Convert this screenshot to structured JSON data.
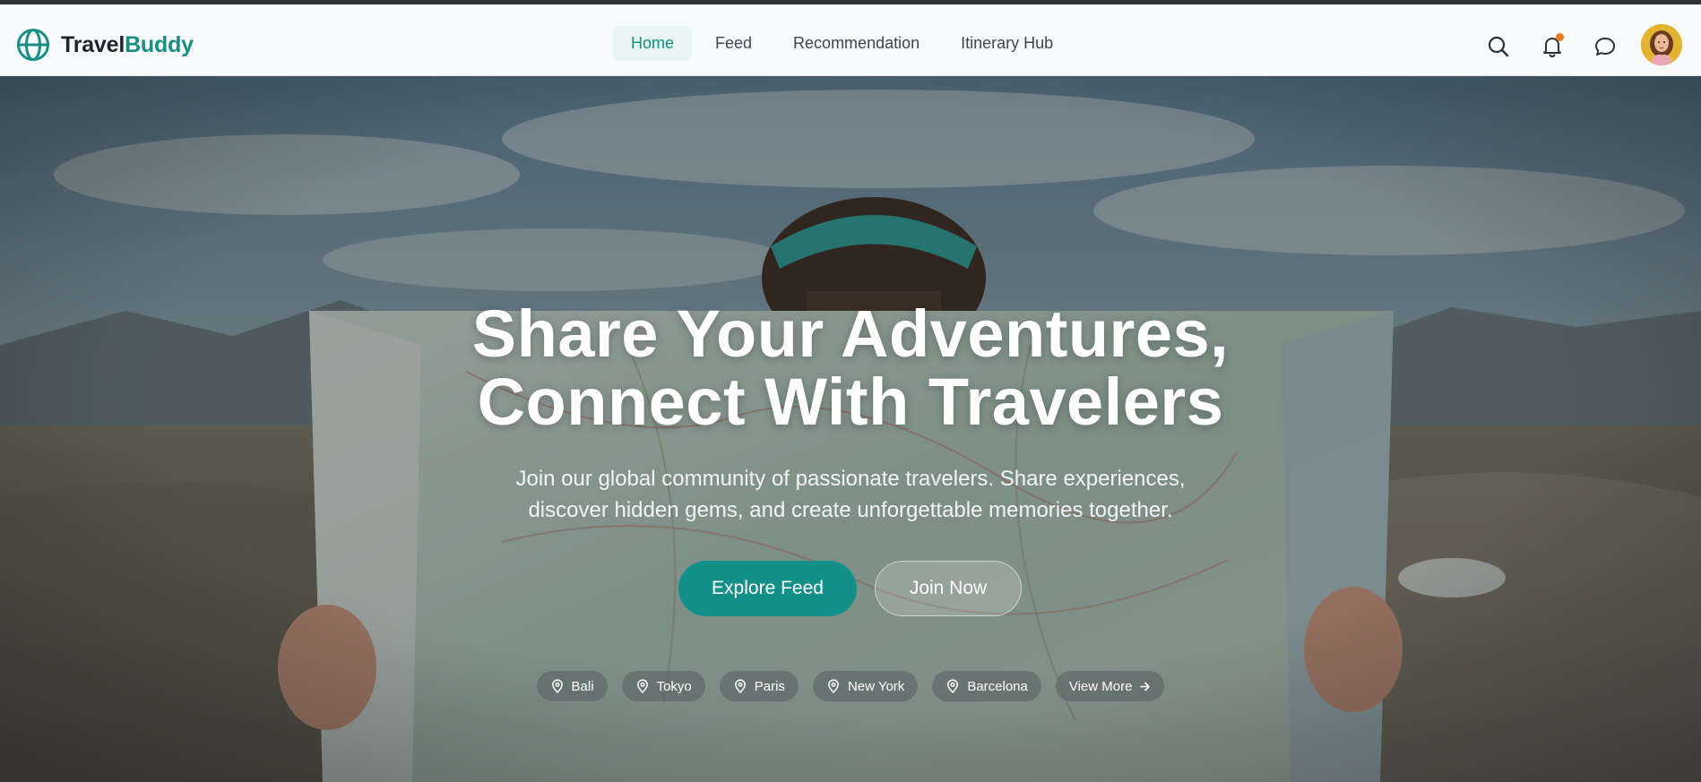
{
  "brand": {
    "name_part1": "Travel",
    "name_part2": "Buddy"
  },
  "nav": {
    "items": [
      {
        "label": "Home",
        "active": true
      },
      {
        "label": "Feed",
        "active": false
      },
      {
        "label": "Recommendation",
        "active": false
      },
      {
        "label": "Itinerary Hub",
        "active": false
      }
    ]
  },
  "header_icons": [
    "search-icon",
    "bell-icon",
    "chat-bubble-icon"
  ],
  "notification_dot": true,
  "hero": {
    "title_line1": "Share Your Adventures,",
    "title_line2": "Connect With Travelers",
    "subtitle_line1": "Join our global community of passionate travelers. Share experiences,",
    "subtitle_line2": "discover hidden gems, and create unforgettable memories together.",
    "primary_button": "Explore Feed",
    "secondary_button": "Join Now"
  },
  "destinations": [
    "Bali",
    "Tokyo",
    "Paris",
    "New York",
    "Barcelona"
  ],
  "view_more": "View More",
  "colors": {
    "accent": "#168f85",
    "active_nav_bg": "#e8f5f2",
    "notification": "#f07a22",
    "header_bg": "#f8fafb"
  }
}
